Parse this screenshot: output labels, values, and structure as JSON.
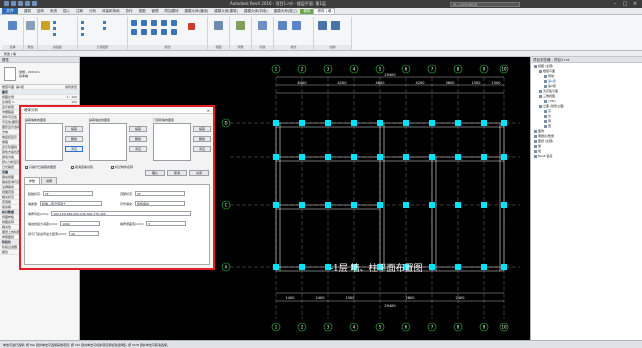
{
  "window": {
    "title": "Autodesk Revit 2016 -      项目1.rvt - 楼层平面: 第1层",
    "search_placeholder": "键入关键字或短语"
  },
  "tabs": [
    "文件",
    "建筑",
    "结构",
    "系统",
    "插入",
    "注释",
    "分析",
    "体量和场地",
    "协作",
    "视图",
    "管理",
    "附加模块",
    "建模大师(通用)",
    "建模大师(建筑)",
    "建模大师(机电)",
    "建模大师(施工)",
    "修改",
    "修改 | 墙"
  ],
  "active_tab_index": 16,
  "ribbon_groups": [
    "选择",
    "属性",
    "剪贴板",
    "几何图形",
    "修改",
    "视图",
    "测量",
    "创建",
    "模式",
    "绘制"
  ],
  "subbar_text": "修改 | 墙",
  "properties": {
    "header": "属性",
    "preview_line1": "常规 - 200mm",
    "preview_line2": "基本墙",
    "edit_type": "编辑类型",
    "rows": [
      {
        "k": "楼层平面: 第1层",
        "v": "编辑类型",
        "sec": false
      },
      {
        "k": "图形",
        "v": "",
        "sec": true
      },
      {
        "k": "视图比例",
        "v": "1 : 100",
        "sec": false
      },
      {
        "k": "比例值 1:",
        "v": "100",
        "sec": false
      },
      {
        "k": "显示模型",
        "v": "标准",
        "sec": false
      },
      {
        "k": "详细程度",
        "v": "粗略",
        "sec": false
      },
      {
        "k": "零件可见性",
        "v": "显示原状态",
        "sec": false
      },
      {
        "k": "可见性/图形替换",
        "v": "编辑...",
        "sec": false
      },
      {
        "k": "图形显示选项",
        "v": "编辑...",
        "sec": false
      },
      {
        "k": "方向",
        "v": "项目北",
        "sec": false
      },
      {
        "k": "墙连接显示",
        "v": "清理所有墙连接",
        "sec": false
      },
      {
        "k": "规程",
        "v": "建筑",
        "sec": false
      },
      {
        "k": "显示隐藏线",
        "v": "按规程",
        "sec": false
      },
      {
        "k": "颜色方案位置",
        "v": "背景",
        "sec": false
      },
      {
        "k": "颜色方案",
        "v": "<无>",
        "sec": false
      },
      {
        "k": "默认分析显示样式",
        "v": "无",
        "sec": false
      },
      {
        "k": "日光路径",
        "v": "",
        "sec": false
      },
      {
        "k": "范围",
        "v": "",
        "sec": true
      },
      {
        "k": "裁剪视图",
        "v": "",
        "sec": false
      },
      {
        "k": "裁剪区域可见",
        "v": "",
        "sec": false
      },
      {
        "k": "注释裁剪",
        "v": "",
        "sec": false
      },
      {
        "k": "视图范围",
        "v": "编辑...",
        "sec": false
      },
      {
        "k": "相关标高",
        "v": "第1层",
        "sec": false
      },
      {
        "k": "范围框",
        "v": "无",
        "sec": false
      },
      {
        "k": "截剪裁",
        "v": "不剪裁",
        "sec": false
      },
      {
        "k": "标识数据",
        "v": "",
        "sec": true
      },
      {
        "k": "视图样板",
        "v": "<无>",
        "sec": false
      },
      {
        "k": "视图名称",
        "v": "第1层",
        "sec": false
      },
      {
        "k": "相关性",
        "v": "不相关",
        "sec": false
      },
      {
        "k": "图纸上的标题",
        "v": "",
        "sec": false
      },
      {
        "k": "参照图纸",
        "v": "",
        "sec": false
      },
      {
        "k": "阶段化",
        "v": "",
        "sec": true
      },
      {
        "k": "阶段过滤器",
        "v": "全部显示",
        "sec": false
      },
      {
        "k": "相位",
        "v": "新构造",
        "sec": false
      }
    ],
    "help_link": "属性帮助",
    "apply": "应用"
  },
  "project_browser": {
    "header": "项目浏览器 - 项目1.rvt",
    "items": [
      {
        "label": "视图 (全部)",
        "indent": 0
      },
      {
        "label": "楼层平面",
        "indent": 1
      },
      {
        "label": "场地",
        "indent": 2
      },
      {
        "label": "第1层",
        "indent": 2,
        "sel": true
      },
      {
        "label": "第2层",
        "indent": 2
      },
      {
        "label": "天花板平面",
        "indent": 1
      },
      {
        "label": "三维视图",
        "indent": 1
      },
      {
        "label": "{3D}",
        "indent": 2
      },
      {
        "label": "立面 (建筑立面)",
        "indent": 1
      },
      {
        "label": "东",
        "indent": 2
      },
      {
        "label": "北",
        "indent": 2
      },
      {
        "label": "南",
        "indent": 2
      },
      {
        "label": "西",
        "indent": 2
      },
      {
        "label": "图例",
        "indent": 0
      },
      {
        "label": "明细表/数量",
        "indent": 0
      },
      {
        "label": "图纸 (全部)",
        "indent": 0
      },
      {
        "label": "族",
        "indent": 0
      },
      {
        "label": "组",
        "indent": 0
      },
      {
        "label": "Revit 链接",
        "indent": 0
      }
    ]
  },
  "dialog": {
    "title": "墙体分析",
    "list_titles": [
      "提取墙体的图层",
      "提取墙边线图层",
      "门窗和墙的图层"
    ],
    "btn_extract": "提取",
    "btn_delete": "删除",
    "btn_clear": "清空",
    "check_only_walls": "只提升已提取的图层",
    "check_wall_edges": "取消连墙识别",
    "check_mark": "标记构件名称",
    "btn_select": "确认",
    "btn_cancel": "取消",
    "btn_close": "关闭",
    "tab_params": "参数",
    "tab_desc": "说明",
    "fields": [
      {
        "label": "起始标高:",
        "value": "1F"
      },
      {
        "label": "墙类型:",
        "value": "砼墙—现浇混凝土"
      },
      {
        "label": "墙厚列表(mm):",
        "value": "100,150,180,200,240,300,370,400"
      },
      {
        "label": "墙边线最大间距(mm):",
        "value": "1000"
      },
      {
        "label": "窗与门窗边界最大距离(mm):",
        "value": "50"
      }
    ],
    "right_fields": [
      {
        "label": "顶部标高:",
        "value": "2F"
      },
      {
        "label": "背景填充:",
        "value": "纯色填充"
      },
      {
        "label": "墙厚误差值(mm):",
        "value": "5"
      }
    ]
  },
  "drawing": {
    "title": "-1层 墙、柱平面布置图",
    "dims_top": [
      "29400",
      "8400",
      "4200",
      "4800",
      "4200",
      "3600",
      "1500",
      "1500"
    ],
    "dims_bottom": [
      "29400",
      "1400",
      "2400",
      "1500",
      "2800",
      "2400"
    ],
    "axis_letters": [
      "D",
      "C",
      "A"
    ],
    "axis_numbers": [
      "1",
      "2",
      "3",
      "4",
      "5",
      "6",
      "7",
      "8",
      "9",
      "10"
    ]
  },
  "status": "单击可进行选择; 按 Tab 键并单击可选择其他项目; 按 Ctrl 键并单击可将新项目添加到选择集; 按 Shift 键并单击可取消选择。",
  "status_right": "主模型"
}
